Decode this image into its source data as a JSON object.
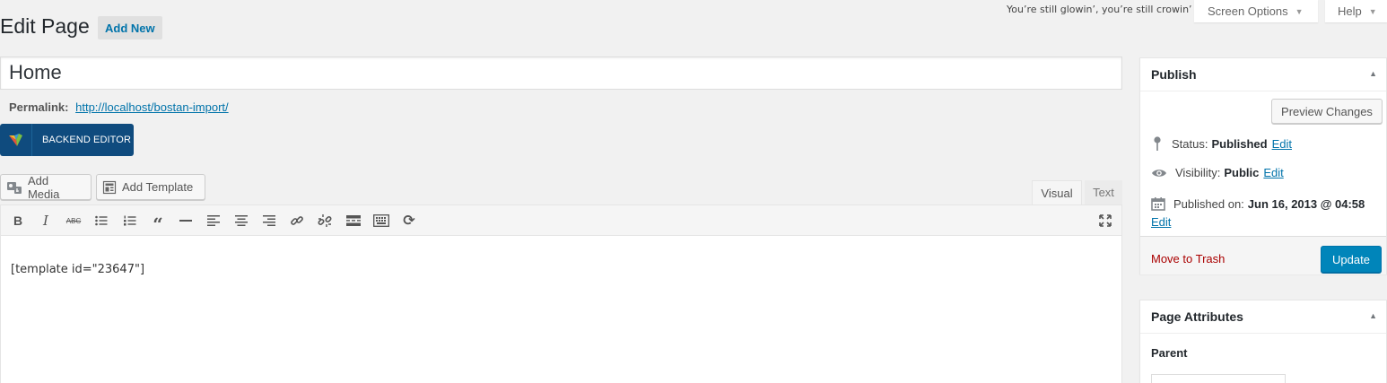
{
  "header": {
    "lyric": "You’re still glowin’, you’re still crowin’",
    "screen_options": "Screen Options",
    "help": "Help",
    "page_title": "Edit Page",
    "add_new": "Add New"
  },
  "post": {
    "title": "Home",
    "permalink_label": "Permalink:",
    "permalink_url": "http://localhost/bostan-import/"
  },
  "builder": {
    "backend_editor": "BACKEND EDITOR"
  },
  "media": {
    "add_media": "Add Media",
    "add_template": "Add Template"
  },
  "editor": {
    "tab_visual": "Visual",
    "tab_text": "Text",
    "content": "[template id=\"23647\"]",
    "toolbar_icons": [
      "bold-icon",
      "italic-icon",
      "strikethrough-icon",
      "bulleted-list-icon",
      "numbered-list-icon",
      "blockquote-icon",
      "horizontal-line-icon",
      "align-left-icon",
      "align-center-icon",
      "align-right-icon",
      "insert-link-icon",
      "remove-link-icon",
      "read-more-icon",
      "toolbar-toggle-icon",
      "refresh-icon",
      "fullscreen-icon"
    ]
  },
  "publish": {
    "title": "Publish",
    "preview_changes": "Preview Changes",
    "status_label": "Status:",
    "status_value": "Published",
    "visibility_label": "Visibility:",
    "visibility_value": "Public",
    "published_label": "Published on:",
    "published_value": "Jun 16, 2013 @ 04:58",
    "edit": "Edit",
    "move_to_trash": "Move to Trash",
    "update": "Update"
  },
  "page_attributes": {
    "title": "Page Attributes",
    "parent_label": "Parent"
  },
  "colors": {
    "link": "#0073aa",
    "primary_button": "#0085ba",
    "builder_button": "#0f4b7e",
    "trash": "#aa0000",
    "background": "#f1f1f1"
  }
}
